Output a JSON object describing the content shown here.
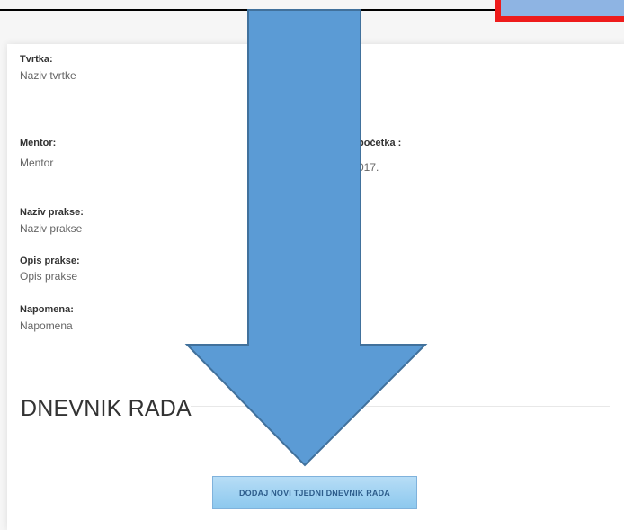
{
  "details": {
    "company_label": "Tvrtka:",
    "company_value": "Naziv tvrtke",
    "mentor_label": "Mentor:",
    "mentor_value": "Mentor",
    "start_label_partial": "početka :",
    "start_value_partial": "017.",
    "internship_name_label": "Naziv prakse:",
    "internship_name_value": "Naziv prakse",
    "description_label": "Opis prakse:",
    "description_value": "Opis prakse",
    "note_label": "Napomena:",
    "note_value": "Napomena"
  },
  "diary": {
    "title": "DNEVNIK RADA",
    "add_button_label": "DODAJ NOVI TJEDNI DNEVNIK RADA"
  },
  "colors": {
    "arrow_fill": "#5b9bd5",
    "arrow_stroke": "#41719c",
    "corner_box_border": "#ee1c1c",
    "corner_box_fill": "#8eb4e3",
    "button_fill": "#9fd1f2"
  }
}
